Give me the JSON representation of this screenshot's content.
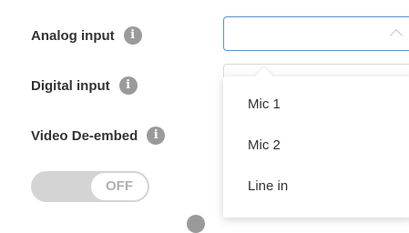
{
  "form": {
    "analog_label": "Analog input",
    "digital_label": "Digital input",
    "video_label": "Video De-embed",
    "info_glyph": "i"
  },
  "toggle": {
    "state_label": "OFF"
  },
  "dropdown": {
    "options": [
      "Mic 1",
      "Mic 2",
      "Line in"
    ]
  },
  "colors": {
    "focus_border": "#5d8fd6",
    "info_icon": "#9a9a9a",
    "toggle_track": "#d4d4d4"
  }
}
